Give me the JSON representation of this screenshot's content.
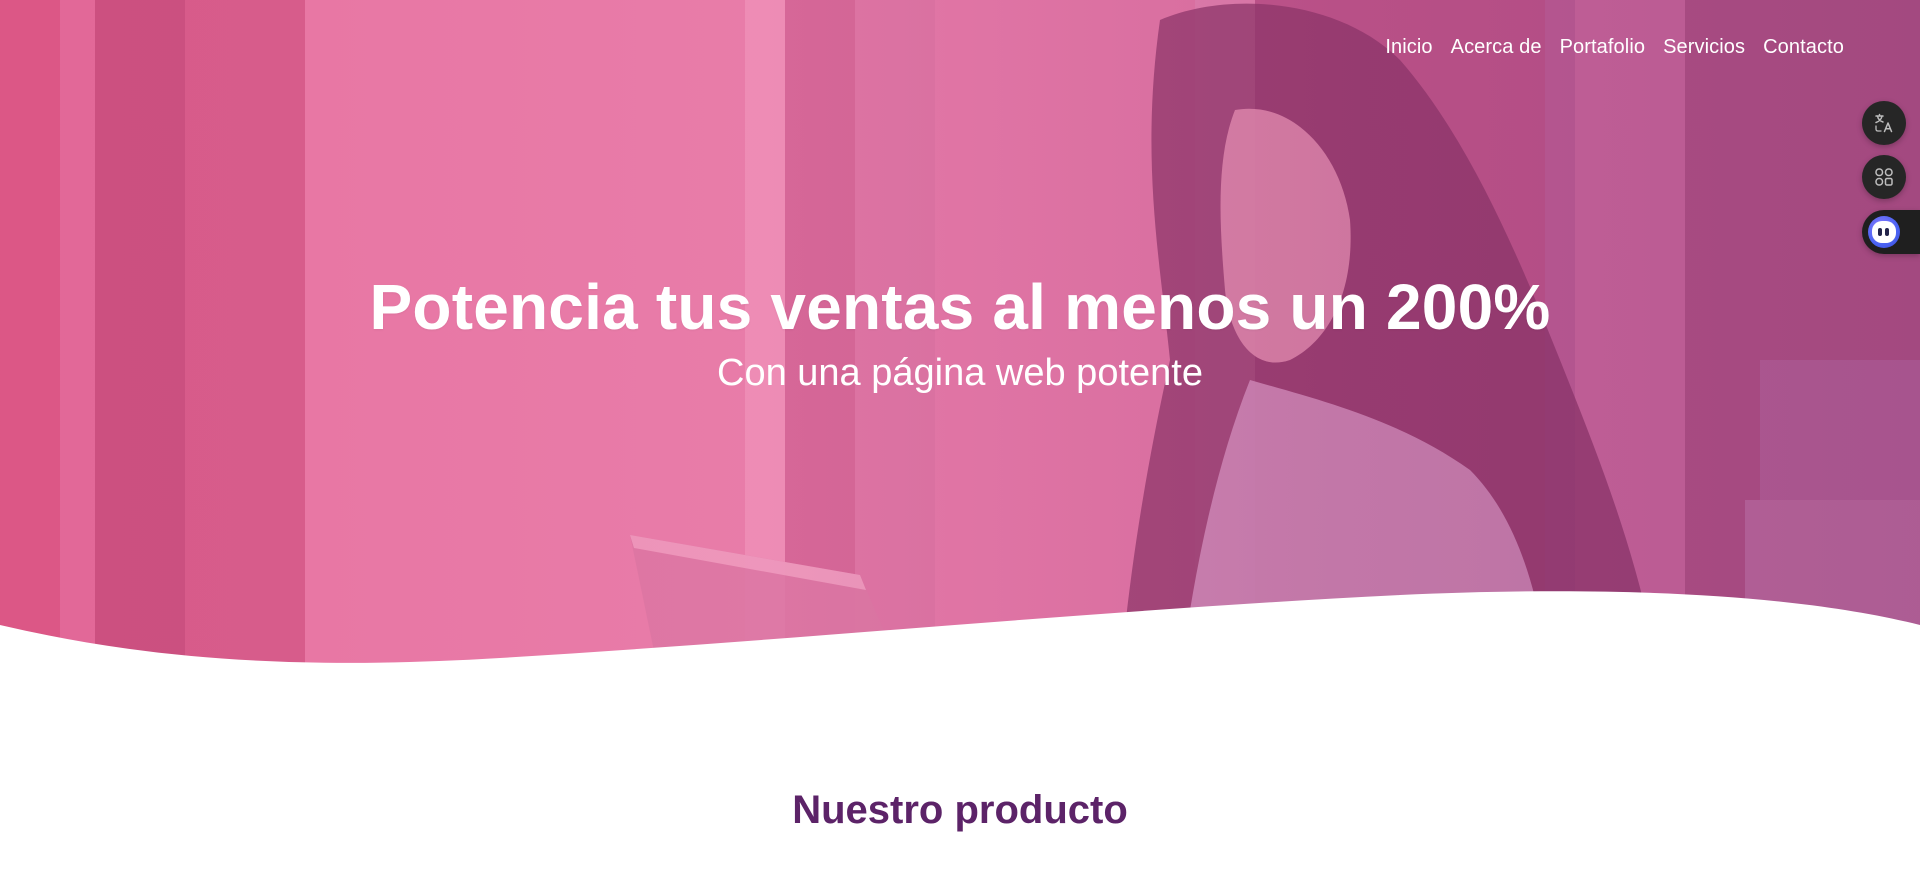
{
  "nav": {
    "items": [
      {
        "label": "Inicio"
      },
      {
        "label": "Acerca de"
      },
      {
        "label": "Portafolio"
      },
      {
        "label": "Servicios"
      },
      {
        "label": "Contacto"
      }
    ]
  },
  "hero": {
    "title": "Potencia tus ventas al menos un 200%",
    "subtitle": "Con una página web potente",
    "image": "woman-with-laptop-photo"
  },
  "section": {
    "title": "Nuestro producto"
  },
  "widgets": {
    "translate": {
      "icon": "translate-icon"
    },
    "apps": {
      "icon": "apps-grid-icon"
    },
    "assistant": {
      "icon": "assistant-bot-icon"
    }
  },
  "colors": {
    "hero_overlay": "#e0709f",
    "section_title": "#5c2368",
    "widget_bg": "#262626",
    "assistant_accent": "#4a63f2"
  }
}
